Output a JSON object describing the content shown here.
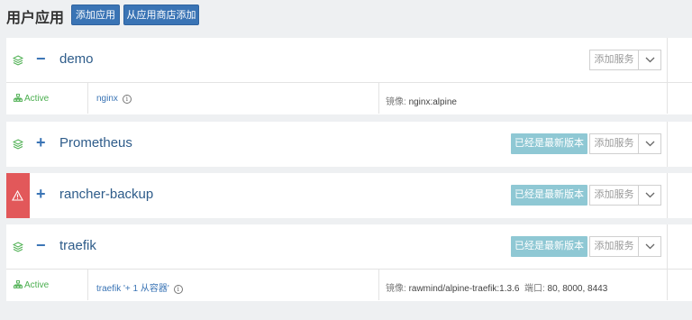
{
  "header": {
    "title": "用户应用",
    "add_app": "添加应用",
    "add_from_store": "从应用商店添加"
  },
  "buttons": {
    "add_service": "添加服务",
    "latest_version": "已经是最新版本"
  },
  "stacks": [
    {
      "name": "demo",
      "toggle": "−",
      "services": [
        {
          "status": "Active",
          "name": "nginx",
          "image_label": "镜像:",
          "image": "nginx:alpine"
        }
      ]
    },
    {
      "name": "Prometheus",
      "toggle": "+"
    },
    {
      "name": "rancher-backup",
      "toggle": "+",
      "warning": "⚠"
    },
    {
      "name": "traefik",
      "toggle": "−",
      "services": [
        {
          "status": "Active",
          "name": "traefik '+ 1 从容器'",
          "image_label": "镜像:",
          "image": "rawmind/alpine-traefik:1.3.6",
          "ports_label": "端口:",
          "ports": "80, 8000, 8443"
        }
      ]
    }
  ],
  "colors": {
    "primary": "#3a74b5",
    "active": "#4caf50",
    "latest": "#8fc8d4",
    "warning": "#e2585a"
  }
}
